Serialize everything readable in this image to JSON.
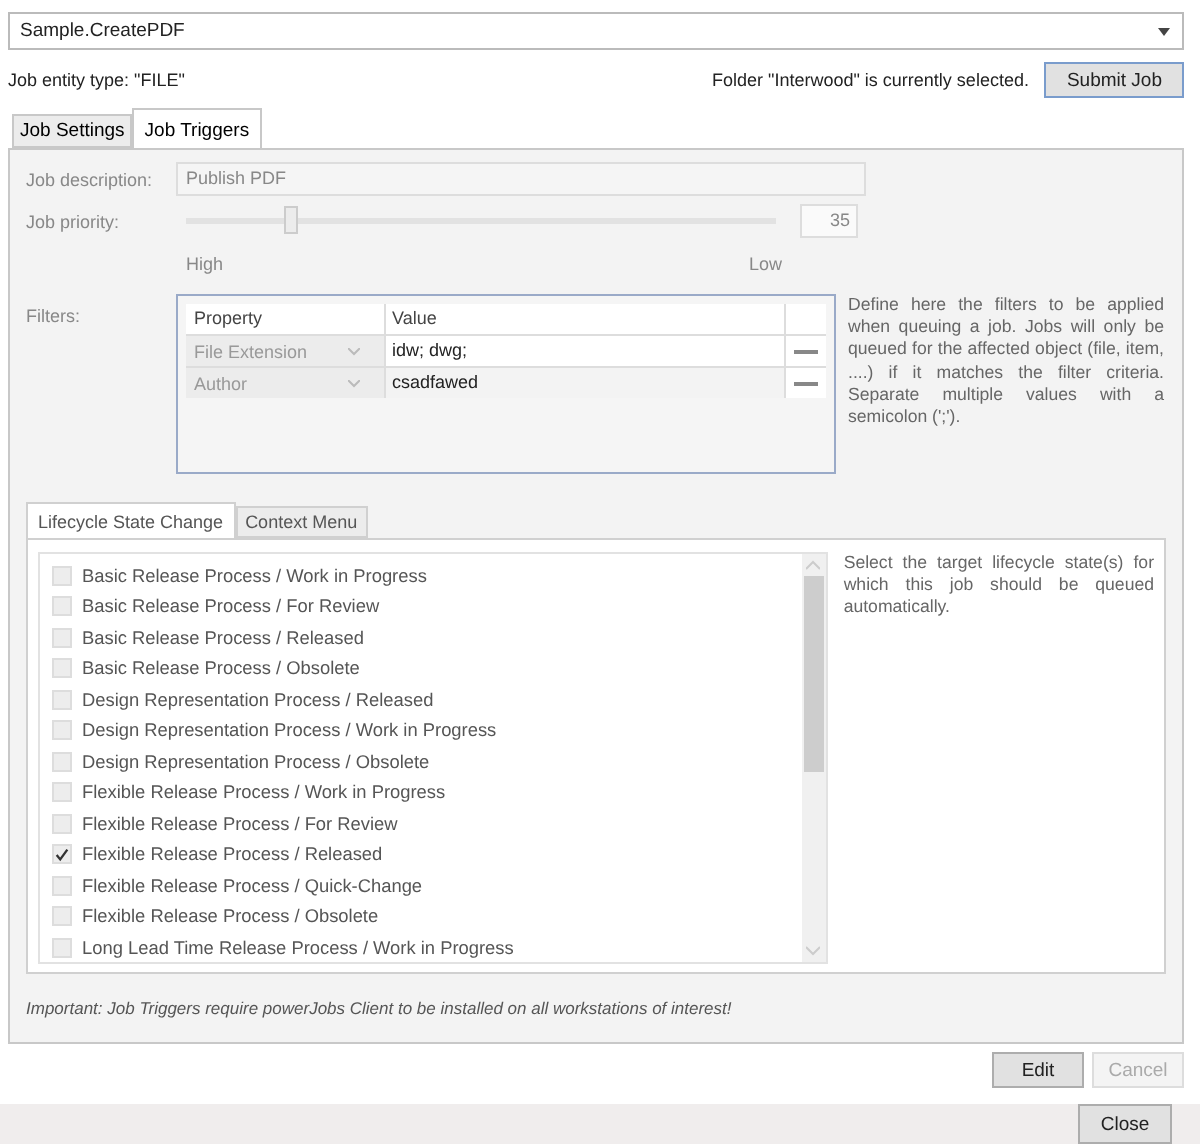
{
  "job_type": {
    "value": "Sample.CreatePDF"
  },
  "entity_type": "Job entity type: \"FILE\"",
  "folder_status": "Folder \"Interwood\" is currently selected.",
  "submit_button": "Submit Job",
  "tabs": [
    {
      "label": "Job Settings",
      "selected": false
    },
    {
      "label": "Job Triggers",
      "selected": true
    }
  ],
  "job_description": {
    "label": "Job description:",
    "value": "Publish PDF",
    "disabled": true
  },
  "job_priority": {
    "label": "Job priority:",
    "level": 0.18,
    "value": "35",
    "min_label": "High",
    "max_label": "Low"
  },
  "filters": {
    "label": "Filters:",
    "columns": [
      "Property",
      "Value"
    ],
    "rows": [
      {
        "property": "File Extension",
        "value": "idw; dwg;",
        "editing": true
      },
      {
        "property": "Author",
        "value": "csadfawed",
        "editing": false
      }
    ],
    "help": "Define here the filters to be applied when queuing a job. Jobs will only be queued for the affected object (file, item, ....) if it matches the filter criteria. Separate multiple values with a semicolon (';')."
  },
  "trigger_tabs": [
    {
      "label": "Lifecycle State Change",
      "selected": true
    },
    {
      "label": "Context Menu",
      "selected": false
    }
  ],
  "lifecycle_states": [
    {
      "label": "Basic Release Process / Work in Progress",
      "checked": false
    },
    {
      "label": "Basic Release Process / For Review",
      "checked": false
    },
    {
      "label": "Basic Release Process / Released",
      "checked": false
    },
    {
      "label": "Basic Release Process / Obsolete",
      "checked": false
    },
    {
      "label": "Design Representation Process / Released",
      "checked": false
    },
    {
      "label": "Design Representation Process / Work in Progress",
      "checked": false
    },
    {
      "label": "Design Representation Process / Obsolete",
      "checked": false
    },
    {
      "label": "Flexible Release Process / Work in Progress",
      "checked": false
    },
    {
      "label": "Flexible Release Process / For Review",
      "checked": false
    },
    {
      "label": "Flexible Release Process / Released",
      "checked": true
    },
    {
      "label": "Flexible Release Process / Quick-Change",
      "checked": false
    },
    {
      "label": "Flexible Release Process / Obsolete",
      "checked": false
    },
    {
      "label": "Long Lead Time Release Process / Work in Progress",
      "checked": false
    }
  ],
  "lifecycle_help": "Select the target lifecycle state(s) for which this job should be queued automatically.",
  "note": "Important: Job Triggers require powerJobs Client to be installed on all workstations of interest!",
  "buttons": [
    {
      "label": "Edit",
      "disabled": false
    },
    {
      "label": "Cancel",
      "disabled": true
    }
  ],
  "close_button": "Close"
}
